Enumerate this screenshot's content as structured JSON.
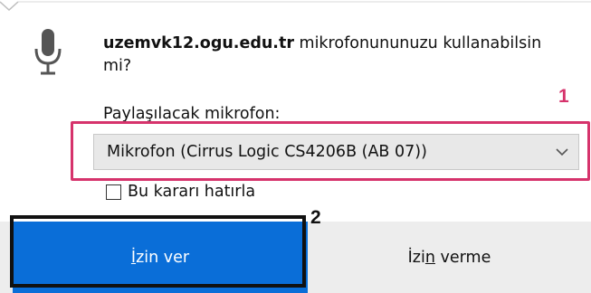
{
  "prompt": {
    "domain": "uzemvk12.ogu.edu.tr",
    "question": " mikrofonununuzu kullanabilsin mi?"
  },
  "microphone": {
    "label": "Paylaşılacak mikrofon:",
    "selected": "Mikrofon (Cirrus Logic CS4206B (AB 07))"
  },
  "remember": {
    "label": "Bu kararı hatırla",
    "checked": false
  },
  "buttons": {
    "allow_accel": "İ",
    "allow_rest": "zin ver",
    "deny_prefix": "İzi",
    "deny_accel": "n",
    "deny_rest": " verme"
  },
  "callouts": {
    "one": "1",
    "two": "2"
  },
  "icons": {
    "mic": "microphone-icon",
    "chevron": "chevron-down-icon"
  },
  "colors": {
    "allow_button": "#0a6ed8",
    "highlight_1": "#d6336c",
    "highlight_2": "#111111"
  }
}
